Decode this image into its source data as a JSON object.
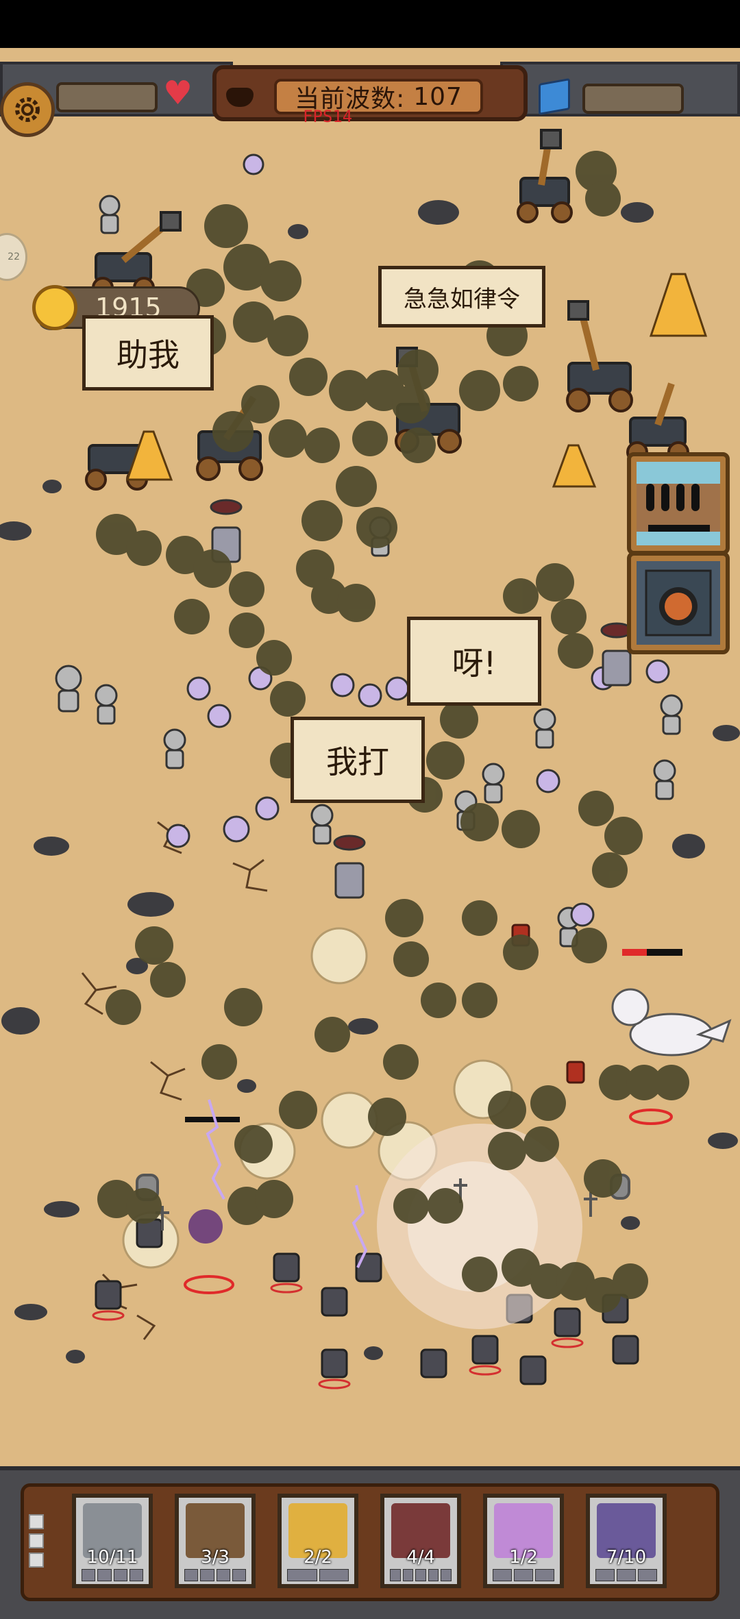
{
  "hud": {
    "wave_label": "当前波数:",
    "wave_number": "107",
    "fps": "FPS14",
    "side_tab": "22"
  },
  "gold": "1915",
  "signs": [
    "助我",
    "急急如律令",
    "呀!",
    "我打"
  ],
  "skills": [
    "volley-skill-icon",
    "cannon-skill-icon"
  ],
  "units": [
    {
      "name": "infantry",
      "count": "10/11",
      "color": "#8a8f95"
    },
    {
      "name": "catapult",
      "count": "3/3",
      "color": "#7a5a3a"
    },
    {
      "name": "monk",
      "count": "2/2",
      "color": "#e0b040"
    },
    {
      "name": "gunner",
      "count": "4/4",
      "color": "#7a3a3a"
    },
    {
      "name": "hero",
      "count": "1/2",
      "color": "#c08ad6"
    },
    {
      "name": "assassin",
      "count": "7/10",
      "color": "#6a5a9a"
    }
  ],
  "colors": {
    "sand": "#ddb983",
    "smoke": "#4f4a2c",
    "heart": "#e33b48",
    "fps": "#d8242a"
  }
}
